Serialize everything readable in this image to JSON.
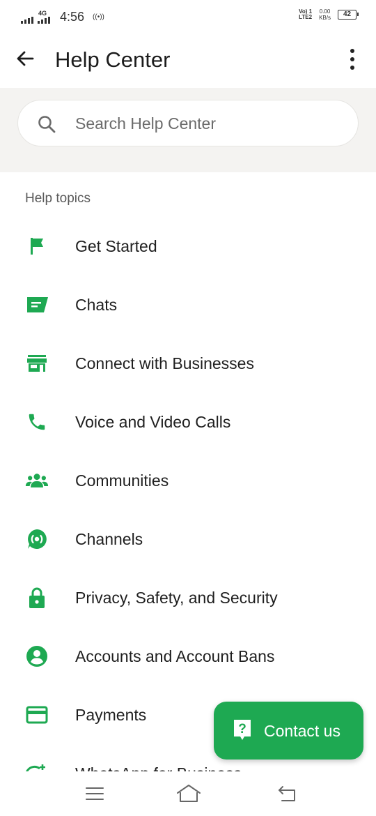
{
  "status_bar": {
    "network": "4G",
    "time": "4:56",
    "hotspot": "((•))",
    "volte_line1": "Vo) 1",
    "volte_line2": "LTE2",
    "speed_value": "0.00",
    "speed_unit": "KB/s",
    "battery": "42"
  },
  "app_bar": {
    "title": "Help Center"
  },
  "search": {
    "placeholder": "Search Help Center"
  },
  "help_topics": {
    "heading": "Help topics",
    "items": [
      {
        "label": "Get Started",
        "icon": "flag-icon"
      },
      {
        "label": "Chats",
        "icon": "chat-bubble-icon"
      },
      {
        "label": "Connect with Businesses",
        "icon": "storefront-icon"
      },
      {
        "label": "Voice and Video Calls",
        "icon": "phone-icon"
      },
      {
        "label": "Communities",
        "icon": "people-group-icon"
      },
      {
        "label": "Channels",
        "icon": "channels-icon"
      },
      {
        "label": "Privacy, Safety, and Security",
        "icon": "lock-icon"
      },
      {
        "label": "Accounts and Account Bans",
        "icon": "account-circle-icon"
      },
      {
        "label": "Payments",
        "icon": "credit-card-icon"
      },
      {
        "label": "WhatsApp for Business",
        "icon": "whatsapp-business-icon"
      }
    ]
  },
  "fab": {
    "label": "Contact us",
    "icon": "help-bubble-icon"
  },
  "colors": {
    "accent": "#1ea952",
    "search_band": "#f4f3f1"
  }
}
